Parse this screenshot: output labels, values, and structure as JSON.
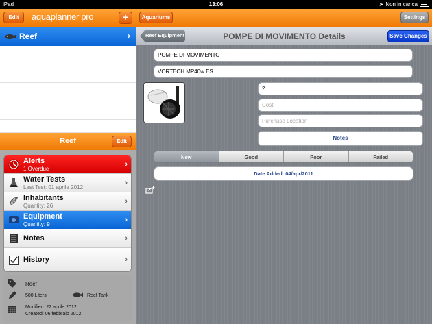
{
  "statusbar": {
    "device": "iPad",
    "time": "13:06",
    "battery": "Non in carica"
  },
  "left": {
    "edit_label": "Edit",
    "logo_text": "aquaplanner",
    "logo_suffix": "pro",
    "add_label": "+",
    "tank_name": "Reef",
    "tank_header_title": "Reef",
    "tank_edit_label": "Edit",
    "menu": [
      {
        "title": "Alerts",
        "subtitle": "1 Overdue",
        "icon": "clock-icon"
      },
      {
        "title": "Water Tests",
        "subtitle": "Last Test: 01 aprile 2012",
        "icon": "flask-icon"
      },
      {
        "title": "Inhabitants",
        "subtitle": "Quantity: 26",
        "icon": "shell-icon"
      },
      {
        "title": "Equipment",
        "subtitle": "Quantity: 9",
        "icon": "equipment-icon"
      },
      {
        "title": "Notes",
        "subtitle": "",
        "icon": "notepad-icon"
      },
      {
        "title": "History",
        "subtitle": "",
        "icon": "checklist-icon"
      }
    ],
    "info": {
      "name": "Reef",
      "volume": "500 Liters",
      "type": "Reef Tank",
      "modified": "Modified: 22 aprile 2012",
      "created": "Created: 06 febbraio 2012"
    }
  },
  "right": {
    "aquariums_label": "Aquariums",
    "settings_label": "Settings",
    "back_label": "Reef Equipment",
    "title": "POMPE DI MOVIMENTO Details",
    "save_label": "Save Changes",
    "name_value": "POMPE DI MOVIMENTO",
    "model_value": "VORTECH MP40w ES",
    "quantity_value": "2",
    "cost_placeholder": "Cost",
    "location_placeholder": "Purchase Location",
    "notes_label": "Notes",
    "conditions": [
      "New",
      "Good",
      "Poor",
      "Failed"
    ],
    "selected_condition": "New",
    "date_added": "Date Added:  04/apr/2011"
  },
  "colors": {
    "orange": "#f07a06",
    "blue_selected": "#0a66d6",
    "alert_red": "#d40000",
    "save_blue": "#0837c9"
  }
}
